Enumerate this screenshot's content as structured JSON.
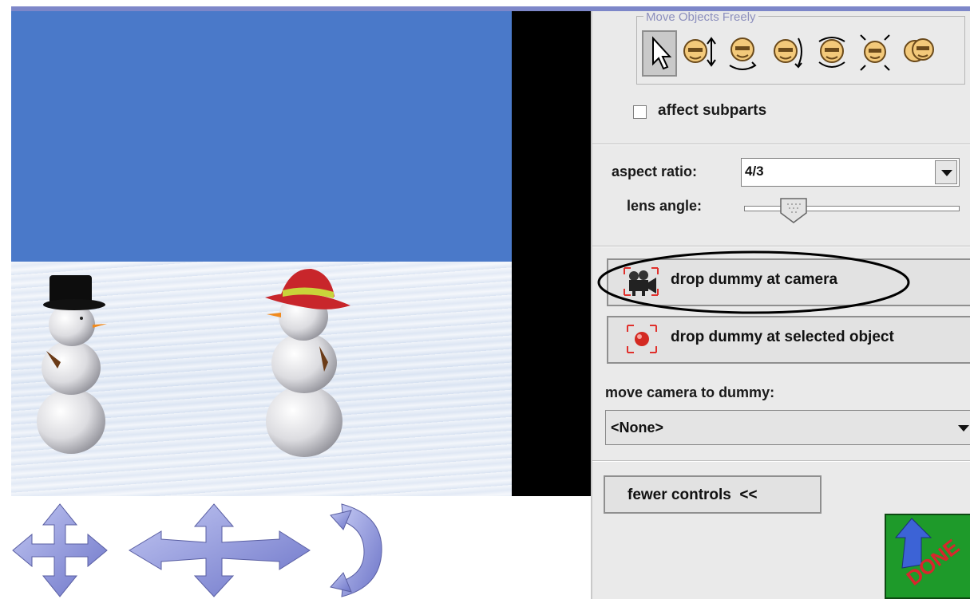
{
  "panel": {
    "group_title": "Move Objects Freely",
    "tools": [
      {
        "name": "pointer-tool-icon",
        "selected": true
      },
      {
        "name": "move-up-down-tool-icon"
      },
      {
        "name": "turn-left-right-tool-icon"
      },
      {
        "name": "turn-forward-back-tool-icon"
      },
      {
        "name": "roll-tool-icon"
      },
      {
        "name": "resize-tool-icon"
      },
      {
        "name": "copy-tool-icon"
      }
    ],
    "affect_subparts_label": "affect subparts",
    "affect_subparts_checked": false,
    "aspect_ratio_label": "aspect ratio:",
    "aspect_ratio_value": "4/3",
    "lens_angle_label": "lens angle:",
    "lens_angle_level": 0.2,
    "drop_camera_label": "drop dummy at camera",
    "drop_selected_label": "drop dummy at selected object",
    "move_camera_label": "move camera to dummy:",
    "move_camera_value": "<None>",
    "fewer_controls_label": "fewer controls  <<",
    "done_label": "DONE"
  },
  "colors": {
    "sky": "#4a79c9",
    "panel": "#eaeaea",
    "accent_blue": "#8c8fbd",
    "done_green": "#1e9a2a",
    "done_red": "#d8262d"
  },
  "scene": {
    "objects": [
      "snowman-top-hat",
      "snowman-red-hat"
    ],
    "nav_controls": [
      "move-arrows-icon",
      "pan-arrows-icon",
      "rotate-arc-icon"
    ]
  }
}
